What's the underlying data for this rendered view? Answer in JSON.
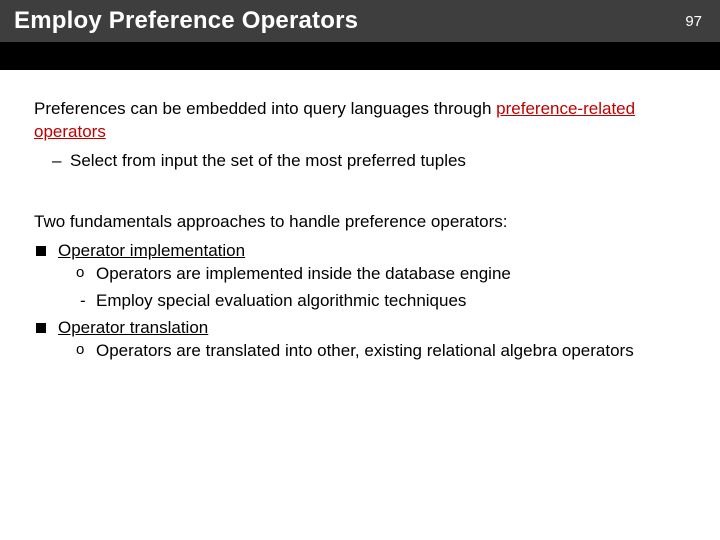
{
  "header": {
    "title": "Employ Preference Operators",
    "page_number": "97"
  },
  "body": {
    "para1_prefix": "Preferences can be embedded into query languages through ",
    "para1_link": "preference-related operators",
    "bullet1": "Select from input the set of the most preferred tuples",
    "para2": "Two fundamentals approaches to handle preference operators:",
    "approach1_label": "Operator implementation",
    "approach1_detail": "Operators are implemented inside the database engine",
    "approach1_sub": "Employ special evaluation algorithmic techniques",
    "approach2_label": "Operator translation",
    "approach2_detail": "Operators are translated into other, existing relational algebra operators"
  }
}
